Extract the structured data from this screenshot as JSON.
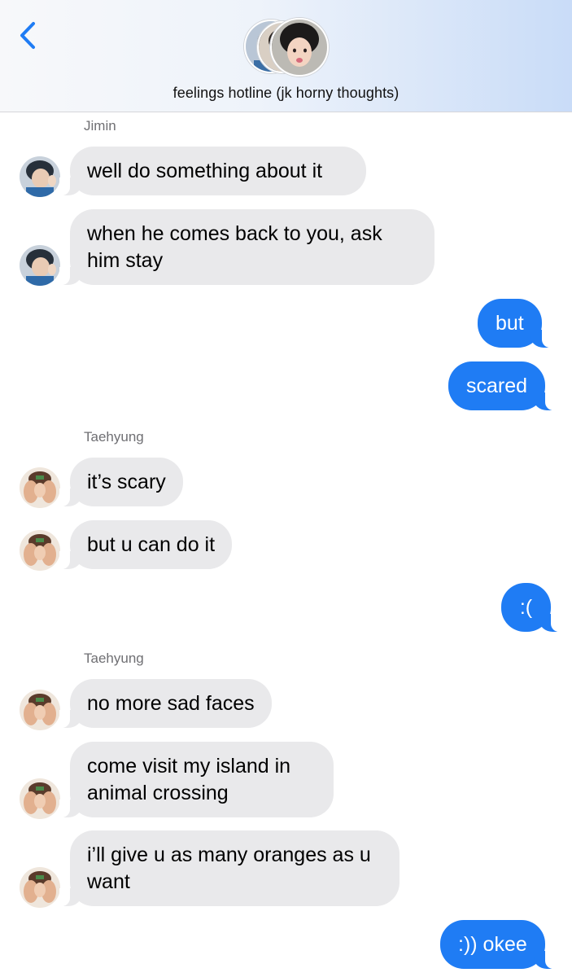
{
  "header": {
    "title": "feelings hotline (jk horny thoughts)",
    "back_icon": "chevron-left-icon",
    "accent_color": "#1f7cf4"
  },
  "messages": [
    {
      "sender": "Jimin",
      "direction": "incoming",
      "text": "well do something about it"
    },
    {
      "sender": "Jimin",
      "direction": "incoming",
      "text": "when he comes back to you, ask him stay"
    },
    {
      "direction": "outgoing",
      "text": "but"
    },
    {
      "direction": "outgoing",
      "text": "scared"
    },
    {
      "sender": "Taehyung",
      "direction": "incoming",
      "text": "it’s scary"
    },
    {
      "sender": "Taehyung",
      "direction": "incoming",
      "text": "but u can do it"
    },
    {
      "direction": "outgoing",
      "text": ":("
    },
    {
      "sender": "Taehyung",
      "direction": "incoming",
      "text": "no more sad faces"
    },
    {
      "sender": "Taehyung",
      "direction": "incoming",
      "text": "come visit my island in animal crossing"
    },
    {
      "sender": "Taehyung",
      "direction": "incoming",
      "text": "i’ll give u as many oranges as u want"
    },
    {
      "direction": "outgoing",
      "text": ":)) okee"
    }
  ],
  "sender_labels": {
    "jimin": "Jimin",
    "taehyung_1": "Taehyung",
    "taehyung_2": "Taehyung"
  },
  "colors": {
    "incoming_bubble": "#e9e9eb",
    "outgoing_bubble": "#1f7cf4",
    "sender_label": "#6f6f73"
  }
}
